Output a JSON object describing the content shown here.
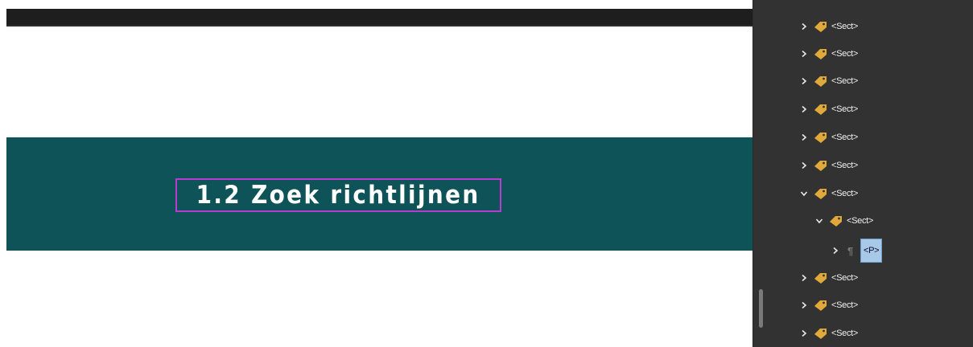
{
  "document": {
    "heading": "1.2 Zoek richtlijnen"
  },
  "tags_panel": {
    "rows": [
      {
        "label": "<Sect>",
        "expanded": false
      },
      {
        "label": "<Sect>",
        "expanded": false
      },
      {
        "label": "<Sect>",
        "expanded": false
      },
      {
        "label": "<Sect>",
        "expanded": false
      },
      {
        "label": "<Sect>",
        "expanded": false
      },
      {
        "label": "<Sect>",
        "expanded": false
      },
      {
        "label": "<Sect>",
        "expanded": true
      },
      {
        "label": "<Sect>",
        "expanded": true
      },
      {
        "label": "<P>",
        "expanded": false,
        "selected": true
      },
      {
        "label": "<Sect>",
        "expanded": false
      },
      {
        "label": "<Sect>",
        "expanded": false
      },
      {
        "label": "<Sect>",
        "expanded": false
      }
    ]
  },
  "colors": {
    "banner": "#0d5357",
    "highlight_border": "#b83ccf",
    "panel_bg": "#323232",
    "tag_icon": "#e0a93a",
    "selection": "#a8c8e8"
  }
}
